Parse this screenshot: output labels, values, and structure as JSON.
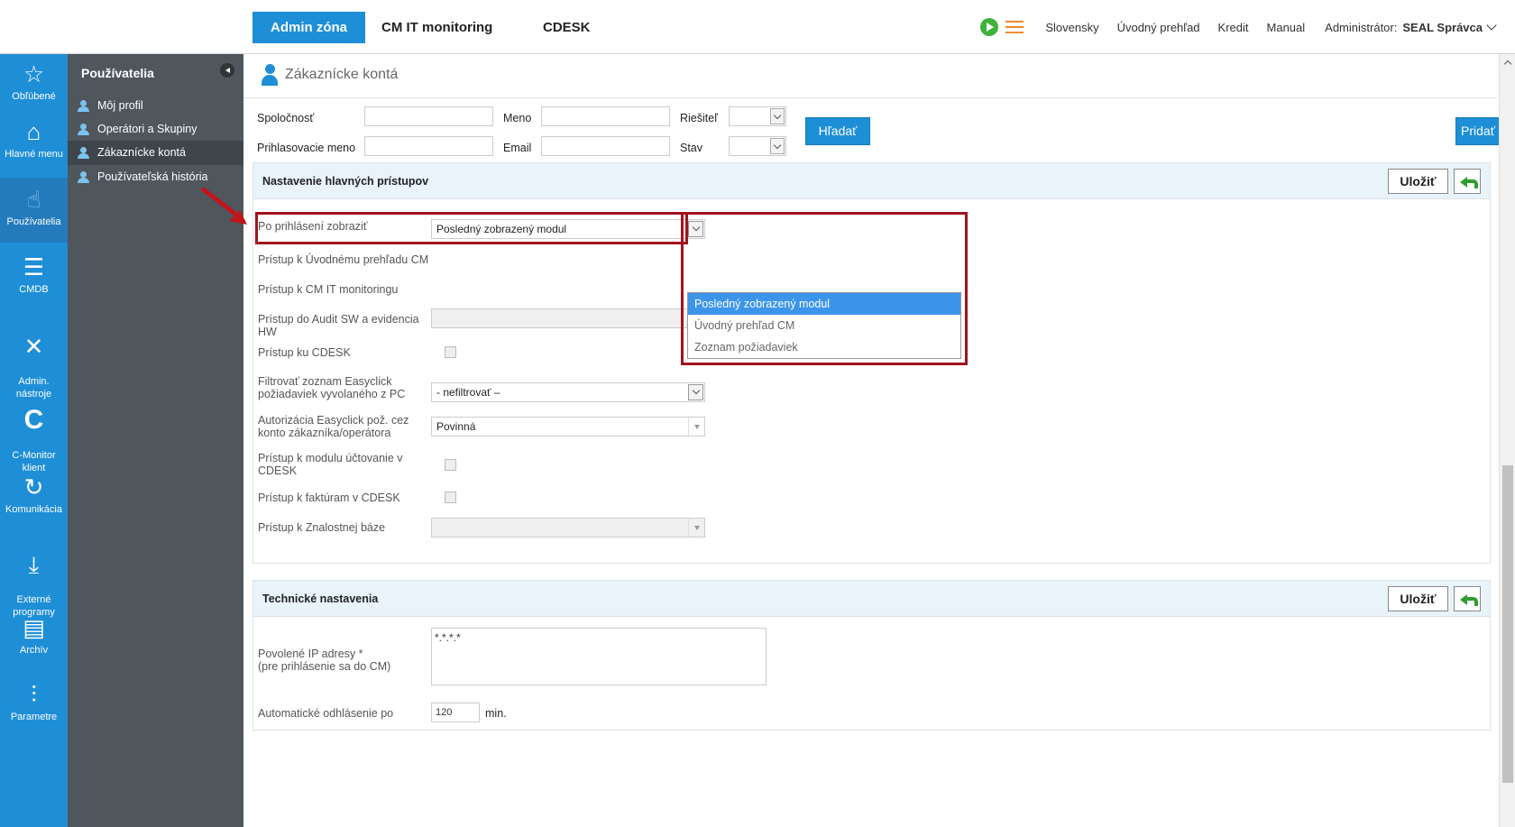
{
  "topbar": {
    "tabs": [
      "Admin zóna",
      "CM IT monitoring",
      "CDESK"
    ],
    "language": "Slovensky",
    "links": [
      "Úvodný prehľad",
      "Kredit",
      "Manual"
    ],
    "admin_label": "Administrátor:",
    "admin_name": "SEAL Správca"
  },
  "leftnav": {
    "items": [
      {
        "label": "Obľúbené",
        "icon": "star-icon"
      },
      {
        "label": "Hlavné menu",
        "icon": "home-icon"
      },
      {
        "label": "Používatelia",
        "icon": "hand-icon"
      },
      {
        "label": "CMDB",
        "icon": "database-icon"
      },
      {
        "label": "Admin.\nnástroje",
        "icon": "tools-icon"
      },
      {
        "label": "C-Monitor\nklient",
        "icon": "c-icon"
      },
      {
        "label": "Komunikácia",
        "icon": "sync-icon"
      },
      {
        "label": "Externé\nprogramy",
        "icon": "download-icon"
      },
      {
        "label": "Archív",
        "icon": "archive-icon"
      },
      {
        "label": "Parametre",
        "icon": "sliders-icon"
      }
    ]
  },
  "sidebar": {
    "title": "Používatelia",
    "items": [
      {
        "label": "Môj profil"
      },
      {
        "label": "Operátori a Skupiny"
      },
      {
        "label": "Zákaznícke kontá"
      },
      {
        "label": "Používateľská história"
      }
    ]
  },
  "page": {
    "title": "Zákaznícke kontá"
  },
  "filter": {
    "company_label": "Spoločnosť",
    "name_label": "Meno",
    "solver_label": "Riešiteľ",
    "login_label": "Prihlasovacie meno",
    "email_label": "Email",
    "status_label": "Stav",
    "search_button": "Hľadať",
    "add_button": "Pridať"
  },
  "access_panel": {
    "title": "Nastavenie hlavných prístupov",
    "save": "Uložiť",
    "rows": {
      "after_login": "Po prihlásení zobraziť",
      "after_login_value": "Posledný zobrazený modul",
      "overview": "Prístup k Úvodnému prehľadu CM",
      "it_monitoring": "Prístup k CM IT monitoringu",
      "audit": "Prístup do Audit SW a evidencia HW",
      "cdesk": "Prístup ku CDESK",
      "filter_easyclick": "Filtrovať zoznam Easyclick požiadaviek vyvolaného z PC",
      "filter_easyclick_value": "- nefiltrovať –",
      "auth_easyclick": "Autorizácia Easyclick pož. cez konto zákazníka/operátora",
      "auth_easyclick_value": "Povinná",
      "billing": "Prístup k modulu účtovanie v CDESK",
      "invoices": "Prístup k faktúram v CDESK",
      "knowledge": "Prístup k Znalostnej báze"
    },
    "dropdown_options": [
      "Posledný zobrazený modul",
      "Úvodný prehľad CM",
      "Zoznam požiadaviek"
    ]
  },
  "tech_panel": {
    "title": "Technické nastavenia",
    "save": "Uložiť",
    "ip_label": "Povolené IP adresy *\n(pre prihlásenie sa do CM)",
    "ip_value": "*.*.*.*",
    "logout_label": "Automatické odhlásenie po",
    "logout_value": "120",
    "logout_unit": "min."
  },
  "colors": {
    "accent": "#1e8ed7",
    "sidebar": "#4f565c",
    "highlight": "#a0141e"
  }
}
